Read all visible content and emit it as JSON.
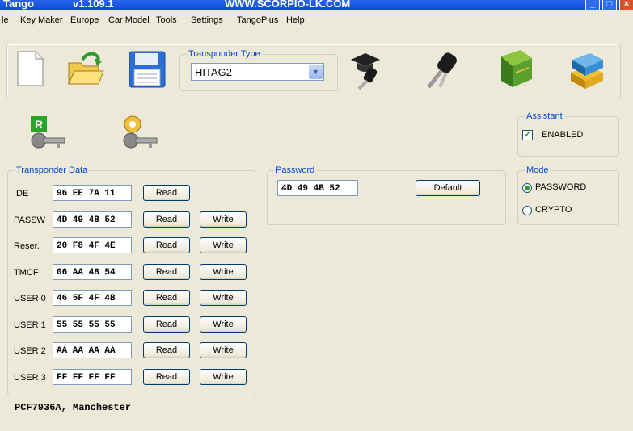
{
  "titlebar": {
    "app": "Tango",
    "version": "v1.109.1",
    "site": "WWW.SCORPIO-LK.COM"
  },
  "menu": [
    "le",
    "Key Maker",
    "Europe",
    "Car Model",
    "Tools",
    "Settings",
    "TangoPlus",
    "Help"
  ],
  "toolbar": {
    "transponder_type_title": "Transponder Type",
    "transponder_type_value": "HITAG2"
  },
  "transponder_data": {
    "title": "Transponder Data",
    "rows": [
      {
        "label": "IDE",
        "value": "96 EE 7A 11",
        "read": "Read",
        "write": ""
      },
      {
        "label": "PASSW",
        "value": "4D 49 4B 52",
        "read": "Read",
        "write": "Write"
      },
      {
        "label": "Reser.",
        "value": "20 F8 4F 4E",
        "read": "Read",
        "write": "Write"
      },
      {
        "label": "TMCF",
        "value": "06 AA 48 54",
        "read": "Read",
        "write": "Write"
      },
      {
        "label": "USER 0",
        "value": "46 5F 4F 4B",
        "read": "Read",
        "write": "Write"
      },
      {
        "label": "USER 1",
        "value": "55 55 55 55",
        "read": "Read",
        "write": "Write"
      },
      {
        "label": "USER 2",
        "value": "AA AA AA AA",
        "read": "Read",
        "write": "Write"
      },
      {
        "label": "USER 3",
        "value": "FF FF FF FF",
        "read": "Read",
        "write": "Write"
      }
    ]
  },
  "password": {
    "title": "Password",
    "value": "4D 49 4B 52",
    "default_label": "Default"
  },
  "assistant": {
    "title": "Assistant",
    "enabled_label": "ENABLED",
    "enabled": true
  },
  "mode": {
    "title": "Mode",
    "options": [
      "PASSWORD",
      "CRYPTO"
    ],
    "selected": "PASSWORD"
  },
  "status": "PCF7936A, Manchester",
  "icon_badge": "R"
}
